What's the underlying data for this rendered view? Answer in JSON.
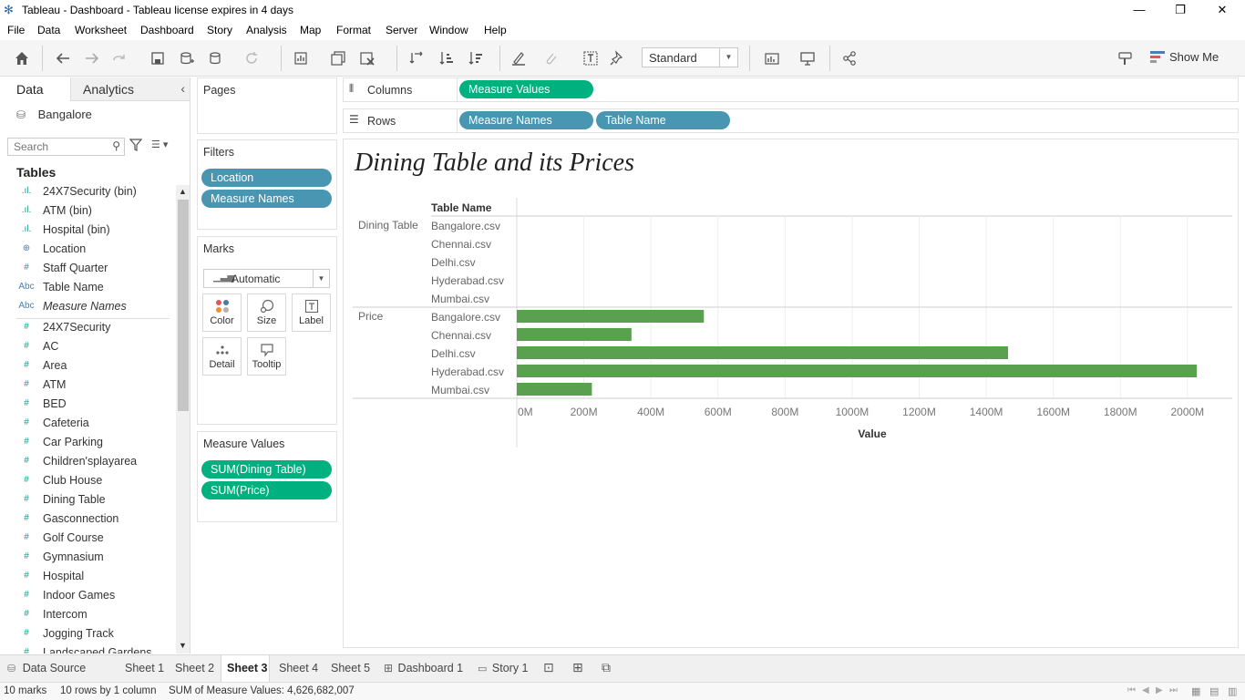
{
  "window": {
    "title": "Tableau - Dashboard - Tableau license expires in 4 days",
    "minimize": "—",
    "restore": "❐",
    "close": "✕"
  },
  "menu": [
    "File",
    "Data",
    "Worksheet",
    "Dashboard",
    "Story",
    "Analysis",
    "Map",
    "Format",
    "Server",
    "Window",
    "Help"
  ],
  "toolbar": {
    "fit_select": "Standard",
    "show_me": "Show Me"
  },
  "data_pane": {
    "tabs": [
      "Data",
      "Analytics"
    ],
    "data_source": "Bangalore",
    "search_placeholder": "Search",
    "tables_heading": "Tables",
    "dimensions": [
      {
        "icon": "bin",
        "name": "24X7Security (bin)"
      },
      {
        "icon": "bin",
        "name": "ATM (bin)"
      },
      {
        "icon": "bin",
        "name": "Hospital (bin)"
      },
      {
        "icon": "globe",
        "name": "Location"
      },
      {
        "icon": "hash",
        "name": "Staff Quarter"
      },
      {
        "icon": "abc",
        "name": "Table Name"
      },
      {
        "icon": "abc",
        "name": "Measure Names"
      }
    ],
    "measures": [
      {
        "icon": "hash",
        "name": "24X7Security"
      },
      {
        "icon": "hash",
        "name": "AC"
      },
      {
        "icon": "hash",
        "name": "Area"
      },
      {
        "icon": "hash",
        "name": "ATM"
      },
      {
        "icon": "hash",
        "name": "BED"
      },
      {
        "icon": "hash",
        "name": "Cafeteria"
      },
      {
        "icon": "hash",
        "name": "Car Parking"
      },
      {
        "icon": "hash",
        "name": "Children'splayarea"
      },
      {
        "icon": "hash",
        "name": "Club House"
      },
      {
        "icon": "hash",
        "name": "Dining Table"
      },
      {
        "icon": "hash",
        "name": "Gasconnection"
      },
      {
        "icon": "hash",
        "name": "Golf Course"
      },
      {
        "icon": "hash",
        "name": "Gymnasium"
      },
      {
        "icon": "hash",
        "name": "Hospital"
      },
      {
        "icon": "hash",
        "name": "Indoor Games"
      },
      {
        "icon": "hash",
        "name": "Intercom"
      },
      {
        "icon": "hash",
        "name": "Jogging Track"
      },
      {
        "icon": "hash",
        "name": "Landscaped Gardens"
      }
    ]
  },
  "cards": {
    "pages": "Pages",
    "filters": "Filters",
    "filter_pills": [
      "Location",
      "Measure Names"
    ],
    "marks": "Marks",
    "marks_type": "Automatic",
    "mark_buttons": [
      "Color",
      "Size",
      "Label",
      "Detail",
      "Tooltip"
    ],
    "measure_values": "Measure Values",
    "measure_value_pills": [
      "SUM(Dining Table)",
      "SUM(Price)"
    ]
  },
  "shelves": {
    "columns_label": "Columns",
    "columns_pills": [
      "Measure Values"
    ],
    "rows_label": "Rows",
    "rows_pills": [
      "Measure Names",
      "Table Name"
    ]
  },
  "viz": {
    "title": "Dining Table and its Prices",
    "row_header": "Table Name",
    "x_axis_title": "Value"
  },
  "chart_data": {
    "type": "bar",
    "orientation": "horizontal",
    "title": "Dining Table and its Prices",
    "xlabel": "Value",
    "ylabel": "Table Name",
    "xlim": [
      0,
      2120000000
    ],
    "x_ticks": [
      "0M",
      "200M",
      "400M",
      "600M",
      "800M",
      "1000M",
      "1200M",
      "1400M",
      "1600M",
      "1800M",
      "2000M"
    ],
    "x_tick_values": [
      0,
      200000000,
      400000000,
      600000000,
      800000000,
      1000000000,
      1200000000,
      1400000000,
      1600000000,
      1800000000,
      2000000000
    ],
    "groups": [
      {
        "name": "Dining Table",
        "categories": [
          "Bangalore.csv",
          "Chennai.csv",
          "Delhi.csv",
          "Hyderabad.csv",
          "Mumbai.csv"
        ],
        "values": [
          0,
          0,
          0,
          0,
          0
        ]
      },
      {
        "name": "Price",
        "categories": [
          "Bangalore.csv",
          "Chennai.csv",
          "Delhi.csv",
          "Hyderabad.csv",
          "Mumbai.csv"
        ],
        "values": [
          558000000,
          342000000,
          1465000000,
          2028000000,
          224000000
        ]
      }
    ],
    "bar_color": "#59a14f",
    "grid": true
  },
  "sheet_tabs": {
    "data_source": "Data Source",
    "sheets": [
      "Sheet 1",
      "Sheet 2",
      "Sheet 3",
      "Sheet 4",
      "Sheet 5"
    ],
    "active": "Sheet 3",
    "dashboard": "Dashboard 1",
    "story": "Story 1"
  },
  "status": {
    "marks": "10 marks",
    "rows": "10 rows by 1 column",
    "sum": "SUM of Measure Values: 4,626,682,007"
  }
}
